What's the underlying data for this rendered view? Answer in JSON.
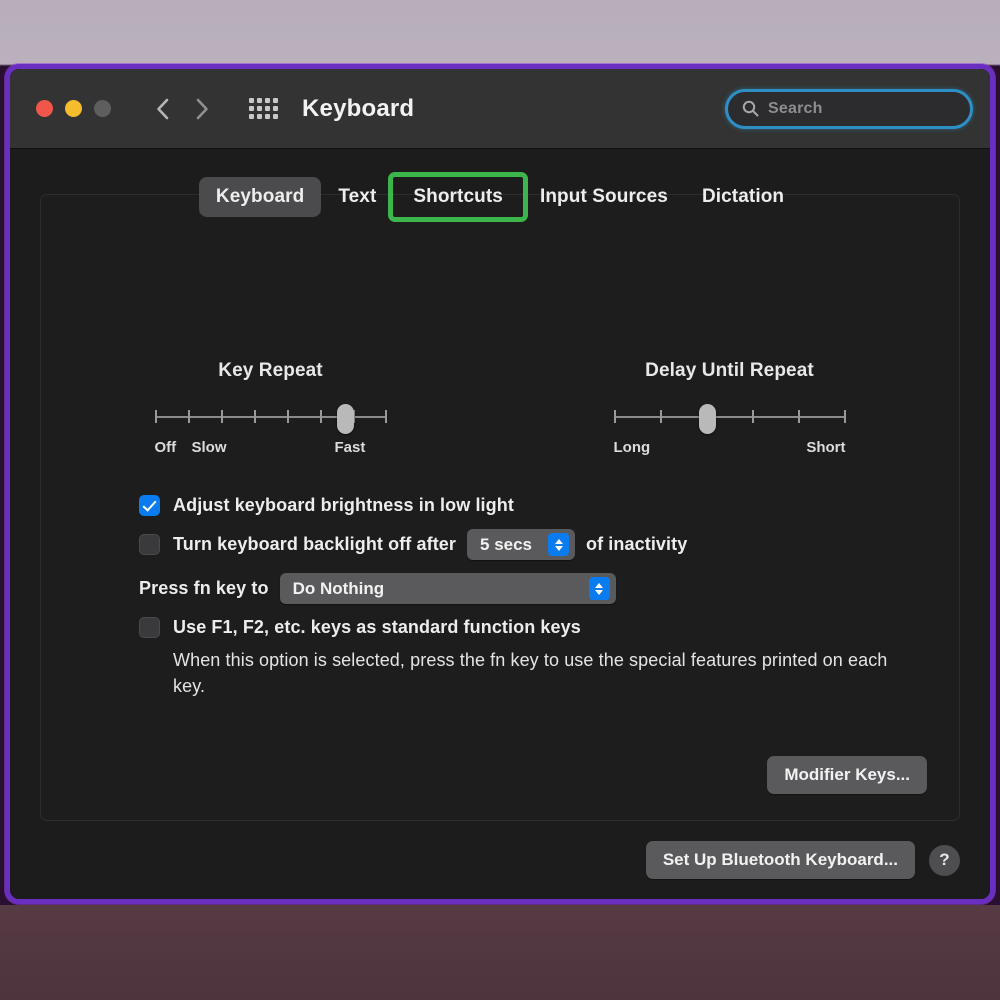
{
  "window": {
    "title": "Keyboard",
    "traffic_lights": [
      "close-red",
      "minimize-yellow",
      "zoom-gray"
    ],
    "nav": {
      "back_icon": "chevron-left-icon",
      "forward_icon": "chevron-right-icon"
    },
    "show_all_icon": "grid-dots-icon"
  },
  "search": {
    "placeholder": "Search",
    "value": "",
    "icon": "search-icon",
    "focus_ring_color": "#2e8fc4"
  },
  "tabs": [
    {
      "label": "Keyboard",
      "selected": true,
      "highlighted": false
    },
    {
      "label": "Text",
      "selected": false,
      "highlighted": false
    },
    {
      "label": "Shortcuts",
      "selected": false,
      "highlighted": true
    },
    {
      "label": "Input Sources",
      "selected": false,
      "highlighted": false
    },
    {
      "label": "Dictation",
      "selected": false,
      "highlighted": false
    }
  ],
  "highlight": {
    "color": "#3cb54a",
    "target": "Shortcuts"
  },
  "sliders": {
    "key_repeat": {
      "title": "Key Repeat",
      "left_label": "Off",
      "second_label": "Slow",
      "right_label": "Fast",
      "ticks": 8,
      "value_index": 7
    },
    "delay_until_repeat": {
      "title": "Delay Until Repeat",
      "left_label": "Long",
      "right_label": "Short",
      "ticks": 6,
      "value_index": 3
    }
  },
  "options": {
    "adjust_brightness": {
      "label": "Adjust keyboard brightness in low light",
      "checked": true
    },
    "backlight_off": {
      "label": "Turn keyboard backlight off after",
      "suffix": "of inactivity",
      "checked": false,
      "popup_value": "5 secs"
    },
    "fn_key": {
      "label": "Press fn key to",
      "popup_value": "Do Nothing"
    },
    "function_keys": {
      "label": "Use F1, F2, etc. keys as standard function keys",
      "checked": false,
      "description": "When this option is selected, press the fn key to use the special features printed on each key."
    }
  },
  "buttons": {
    "modifier_keys": "Modifier Keys...",
    "set_up_bluetooth": "Set Up Bluetooth Keyboard...",
    "help": "?"
  },
  "colors": {
    "accent_blue": "#0a7cf0",
    "highlight_green": "#3cb54a",
    "window_frame": "#6a2ec0",
    "titlebar": "#333333",
    "window_bg": "#1c1c1c"
  }
}
